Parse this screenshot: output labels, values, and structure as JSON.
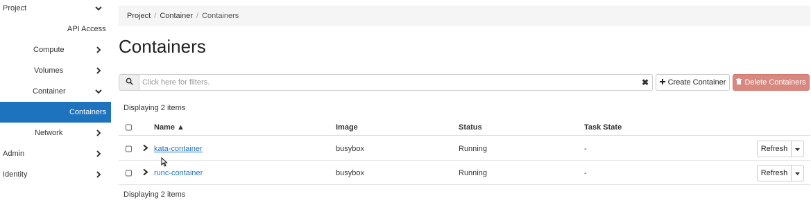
{
  "sidebar": {
    "project": "Project",
    "api_access": "API Access",
    "compute": "Compute",
    "volumes": "Volumes",
    "container": "Container",
    "containers": "Containers",
    "network": "Network",
    "admin": "Admin",
    "identity": "Identity"
  },
  "breadcrumb": {
    "items": [
      "Project",
      "Container",
      "Containers"
    ],
    "separator": "/"
  },
  "page": {
    "title": "Containers"
  },
  "filter": {
    "placeholder": "Click here for filters.",
    "clear": "✖"
  },
  "toolbar": {
    "create_label": "Create Container",
    "delete_label": "Delete Containers"
  },
  "table": {
    "displaying_top": "Displaying 2 items",
    "displaying_bottom": "Displaying 2 items",
    "columns": {
      "name": "Name ▲",
      "image": "Image",
      "status": "Status",
      "task_state": "Task State"
    },
    "rows": [
      {
        "name": "kata-container",
        "image": "busybox",
        "status": "Running",
        "task_state": "-",
        "action": "Refresh"
      },
      {
        "name": "runc-container",
        "image": "busybox",
        "status": "Running",
        "task_state": "-",
        "action": "Refresh"
      }
    ]
  },
  "colors": {
    "accent": "#1e73be",
    "danger": "#d9887f"
  }
}
